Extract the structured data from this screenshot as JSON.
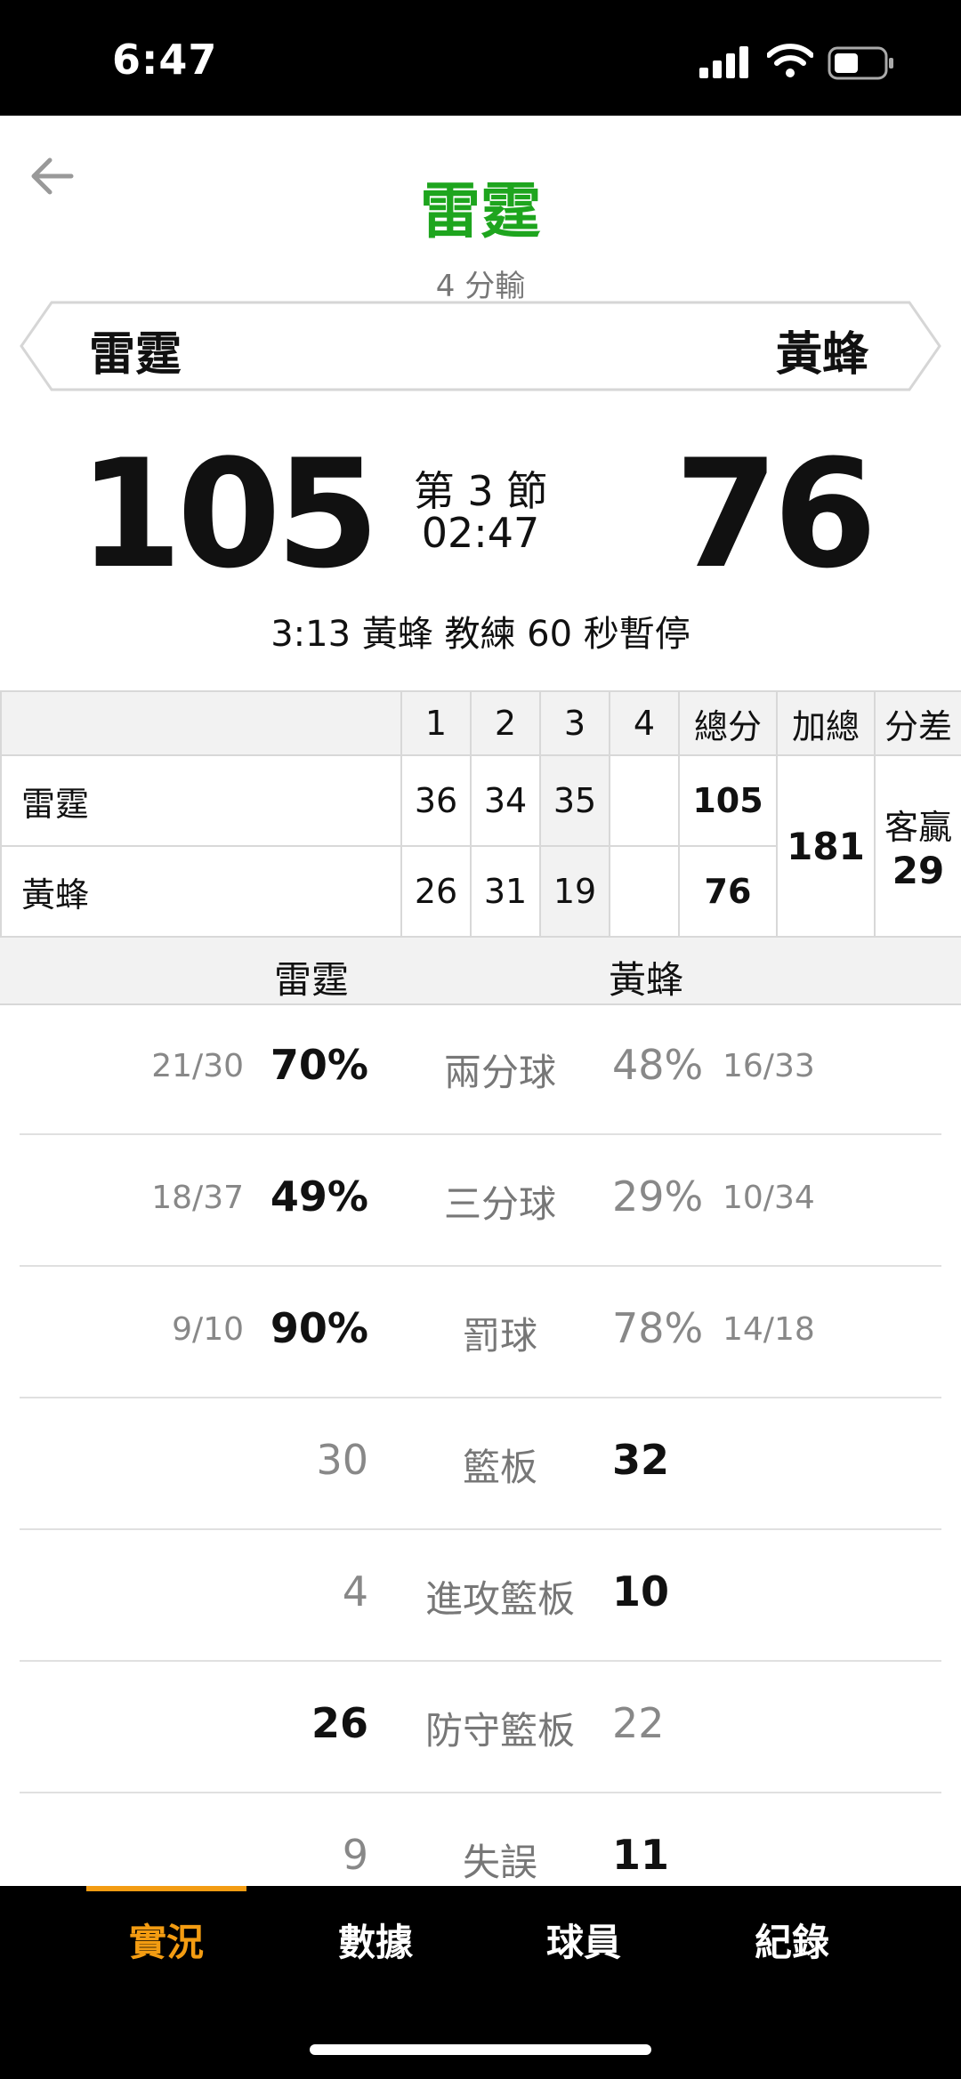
{
  "status": {
    "time": "6:47"
  },
  "header": {
    "title": "雷霆",
    "subtitle": "4 分輸",
    "home_team": "雷霆",
    "away_team": "黃蜂"
  },
  "score": {
    "home": "105",
    "away": "76",
    "period": "第 3 節",
    "clock": "02:47",
    "event": "3:13 黃蜂  教練 60 秒暫停"
  },
  "quarter_table": {
    "headers": [
      "",
      "1",
      "2",
      "3",
      "4",
      "總分",
      "加總",
      "分差"
    ],
    "rows": [
      {
        "team": "雷霆",
        "q1": "36",
        "q2": "34",
        "q3": "35",
        "q4": "",
        "total": "105"
      },
      {
        "team": "黃蜂",
        "q1": "26",
        "q2": "31",
        "q3": "19",
        "q4": "",
        "total": "76"
      }
    ],
    "sum": "181",
    "diff_label": "客贏",
    "diff_value": "29"
  },
  "stats_header": {
    "home": "雷霆",
    "away": "黃蜂"
  },
  "stats": [
    {
      "label": "兩分球",
      "home_frac": "21/30",
      "home_val": "70%",
      "away_val": "48%",
      "away_frac": "16/33"
    },
    {
      "label": "三分球",
      "home_frac": "18/37",
      "home_val": "49%",
      "away_val": "29%",
      "away_frac": "10/34"
    },
    {
      "label": "罰球",
      "home_frac": "9/10",
      "home_val": "90%",
      "away_val": "78%",
      "away_frac": "14/18"
    },
    {
      "label": "籃板",
      "home_frac": "",
      "home_val": "30",
      "away_val": "32",
      "away_frac": ""
    },
    {
      "label": "進攻籃板",
      "home_frac": "",
      "home_val": "4",
      "away_val": "10",
      "away_frac": ""
    },
    {
      "label": "防守籃板",
      "home_frac": "",
      "home_val": "26",
      "away_val": "22",
      "away_frac": ""
    },
    {
      "label": "失誤",
      "home_frac": "",
      "home_val": "9",
      "away_val": "11",
      "away_frac": ""
    }
  ],
  "tabs": [
    "實況",
    "數據",
    "球員",
    "紀錄"
  ],
  "colors": {
    "title_green": "#1ea51e",
    "accent_orange": "#f39c12"
  }
}
